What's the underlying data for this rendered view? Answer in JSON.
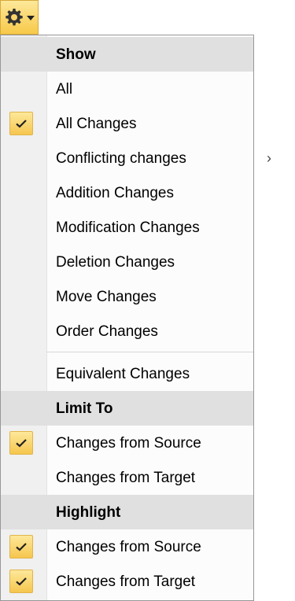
{
  "menu": {
    "show_header": "Show",
    "show_items": [
      {
        "label": "All",
        "checked": false
      },
      {
        "label": "All Changes",
        "checked": true
      },
      {
        "label": "Conflicting changes",
        "checked": false,
        "submenu": true
      },
      {
        "label": "Addition Changes",
        "checked": false
      },
      {
        "label": "Modification Changes",
        "checked": false
      },
      {
        "label": "Deletion Changes",
        "checked": false
      },
      {
        "label": "Move Changes",
        "checked": false
      },
      {
        "label": "Order Changes",
        "checked": false
      }
    ],
    "equivalent_label": "Equivalent Changes",
    "limit_header": "Limit To",
    "limit_items": [
      {
        "label": "Changes from Source",
        "checked": true
      },
      {
        "label": "Changes from Target",
        "checked": false
      }
    ],
    "highlight_header": "Highlight",
    "highlight_items": [
      {
        "label": "Changes from Source",
        "checked": true
      },
      {
        "label": "Changes from Target",
        "checked": true
      }
    ],
    "submenu_arrow": "›"
  },
  "icons": {
    "trigger": "gear-icon",
    "trigger_caret": "chevron-down-icon",
    "check": "checkmark-icon",
    "submenu": "chevron-right-icon"
  },
  "colors": {
    "accent": "#f7c94a",
    "header_bg": "#e0e0e0",
    "gutter": "#f0f0f0",
    "border": "#979797"
  }
}
